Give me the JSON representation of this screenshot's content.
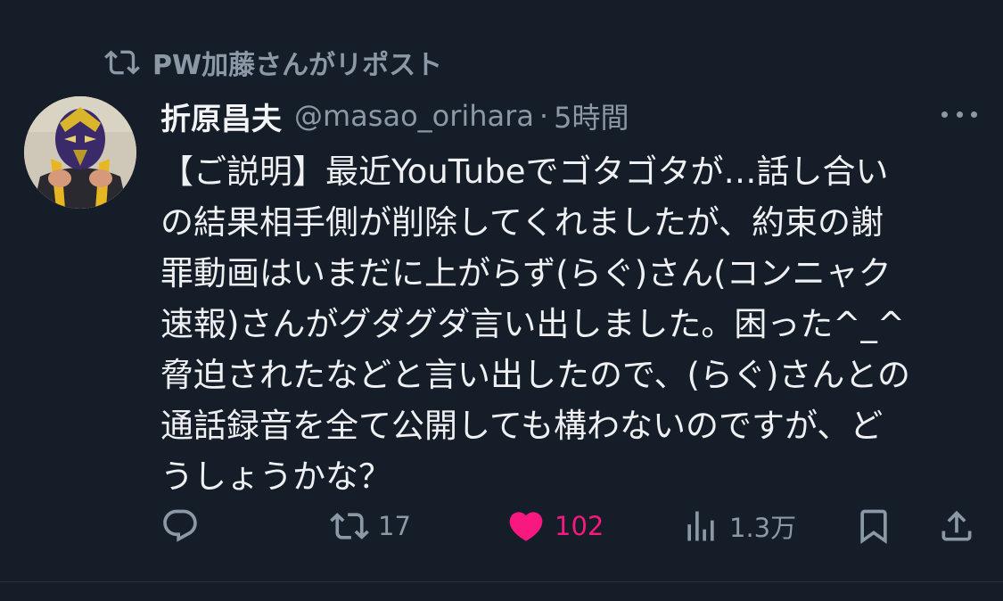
{
  "repost": {
    "label": "PW加藤さんがリポスト",
    "icon": "repost-icon"
  },
  "tweet": {
    "display_name": "折原昌夫",
    "handle": "@masao_orihara",
    "separator": "·",
    "time": "5時間",
    "avatar_icon": "masked-wrestler-avatar",
    "more_icon": "more-horizontal-icon",
    "text_lines": [
      "【ご説明】最近YouTubeでゴタゴタが…話し合い",
      "の結果相手側が削除してくれましたが、約束の謝",
      "罪動画はいまだに上がらず(らぐ)さん(コンニャク",
      "速報)さんがグダグダ言い出しました。困った^_^",
      "脅迫されたなどと言い出したので、(らぐ)さんとの",
      "通話録音を全て公開しても構わないのですが、ど",
      "うしょうかな？"
    ]
  },
  "actions": {
    "reply": {
      "icon": "reply-icon",
      "count": ""
    },
    "repost": {
      "icon": "repost-icon",
      "count": "17"
    },
    "like": {
      "icon": "heart-icon",
      "count": "102",
      "color": "#f91880"
    },
    "views": {
      "icon": "views-icon",
      "count": "1.3万"
    },
    "bookmark": {
      "icon": "bookmark-icon"
    },
    "share": {
      "icon": "share-icon"
    }
  },
  "colors": {
    "background": "#151d28",
    "muted": "#8b98a5",
    "text": "#e7e9ea",
    "like": "#f91880"
  }
}
